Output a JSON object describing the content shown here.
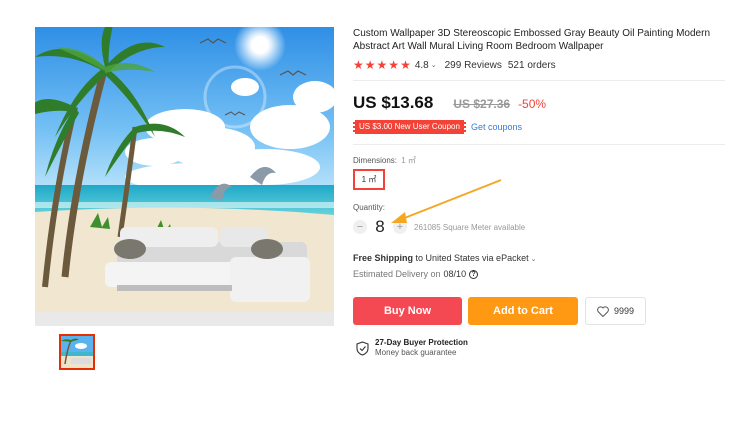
{
  "product": {
    "title": "Custom Wallpaper 3D Stereoscopic Embossed Gray Beauty Oil Painting Modern Abstract Art Wall Mural Living Room Bedroom Wallpaper",
    "rating": "4.8",
    "reviews": "299 Reviews",
    "orders": "521 orders"
  },
  "price": {
    "current": "US $13.68",
    "original": "US $27.36",
    "discount": "-50%"
  },
  "coupon": {
    "label": "US $3.00 New User Coupon",
    "link": "Get coupons"
  },
  "dimensions": {
    "label": "Dimensions:",
    "value": "1 ㎡",
    "option": "1 ㎡"
  },
  "quantity": {
    "label": "Quantity:",
    "minus": "−",
    "value": "8",
    "plus": "+",
    "available": "261085 Square Meter available"
  },
  "shipping": {
    "bold": "Free Shipping",
    "rest": " to United States via ePacket",
    "estimate_label": "Estimated Delivery on",
    "estimate_date": "08/10"
  },
  "actions": {
    "buy_now": "Buy Now",
    "add_to_cart": "Add to Cart",
    "wishlist_count": "9999"
  },
  "protection": {
    "title": "27-Day Buyer Protection",
    "subtitle": "Money back guarantee"
  },
  "colors": {
    "accent_red": "#f44336",
    "buy_now": "#f44853",
    "add_to_cart": "#ff9812",
    "link_blue": "#3a7bd5",
    "annotation_arrow": "#f5a623"
  },
  "icons": [
    "star-icon",
    "heart-icon",
    "shield-check-icon",
    "help-circle-icon",
    "chevron-down-icon",
    "annotation-arrow"
  ]
}
